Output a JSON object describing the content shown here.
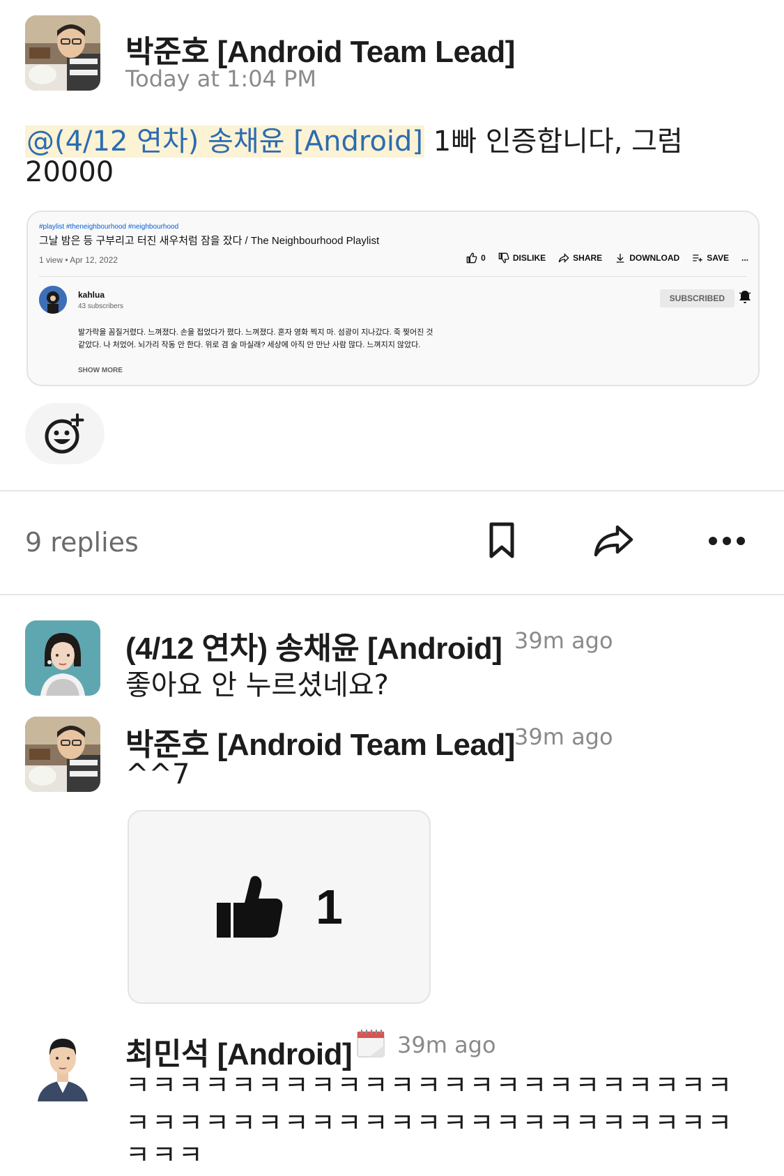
{
  "parent_message": {
    "author": "박준호 [Android Team Lead]",
    "timestamp": "Today at 1:04 PM",
    "mention": "@(4/12 연차) 송채윤 [Android]",
    "text_line1_rest": " 1빠 인증합니다, 그럼",
    "text_line2": "20000"
  },
  "embed": {
    "tags": "#playlist #theneighbourhood #neighbourhood",
    "title": "그날 밤은 등 구부리고 터진 새우처럼 잠을 잤다 / The Neighbourhood Playlist",
    "views": "1 view • Apr 12, 2022",
    "like_count": "0",
    "dislike": "DISLIKE",
    "share": "SHARE",
    "download": "DOWNLOAD",
    "save": "SAVE",
    "more": "...",
    "channel_name": "kahlua",
    "channel_subs": "43 subscribers",
    "subscribed": "SUBSCRIBED",
    "desc_line1": "발가락을 꼼질거렸다. 느껴졌다. 손을 접었다가 폈다. 느껴졌다. 혼자 영화 찍지 마. 섬광이 지나갔다. 죽 찢어진 것",
    "desc_line2": "같았다. 나 처었어. 뇌가리 작동 안 한다. 위로 겸 술 마실래? 세상에 아직 안 만난 사람 많다. 느껴지지 않았다.",
    "show_more": "SHOW MORE"
  },
  "thread_bar": {
    "replies": "9 replies"
  },
  "replies": [
    {
      "author": "(4/12 연차) 송채윤 [Android]",
      "time": "39m ago",
      "text": "좋아요 안 누르셨네요?"
    },
    {
      "author": "박준호 [Android Team Lead]",
      "time": "39m ago",
      "text": "^^7",
      "attachment_count": "1"
    },
    {
      "author": "최민석 [Android]",
      "time": "39m ago",
      "lines": [
        "ㅋㅋㅋㅋㅋㅋㅋㅋㅋㅋㅋㅋㅋㅋㅋㅋㅋㅋㅋㅋㅋㅋㅋ",
        "ㅋㅋㅋㅋㅋㅋㅋㅋㅋㅋㅋㅋㅋㅋㅋㅋㅋㅋㅋㅋㅋㅋㅋ",
        "ㅋㅋㅋ"
      ]
    }
  ],
  "colors": {
    "mention_bg": "#fcf2d4",
    "mention_text": "#2b6cb0",
    "muted": "#8a8a8a"
  }
}
